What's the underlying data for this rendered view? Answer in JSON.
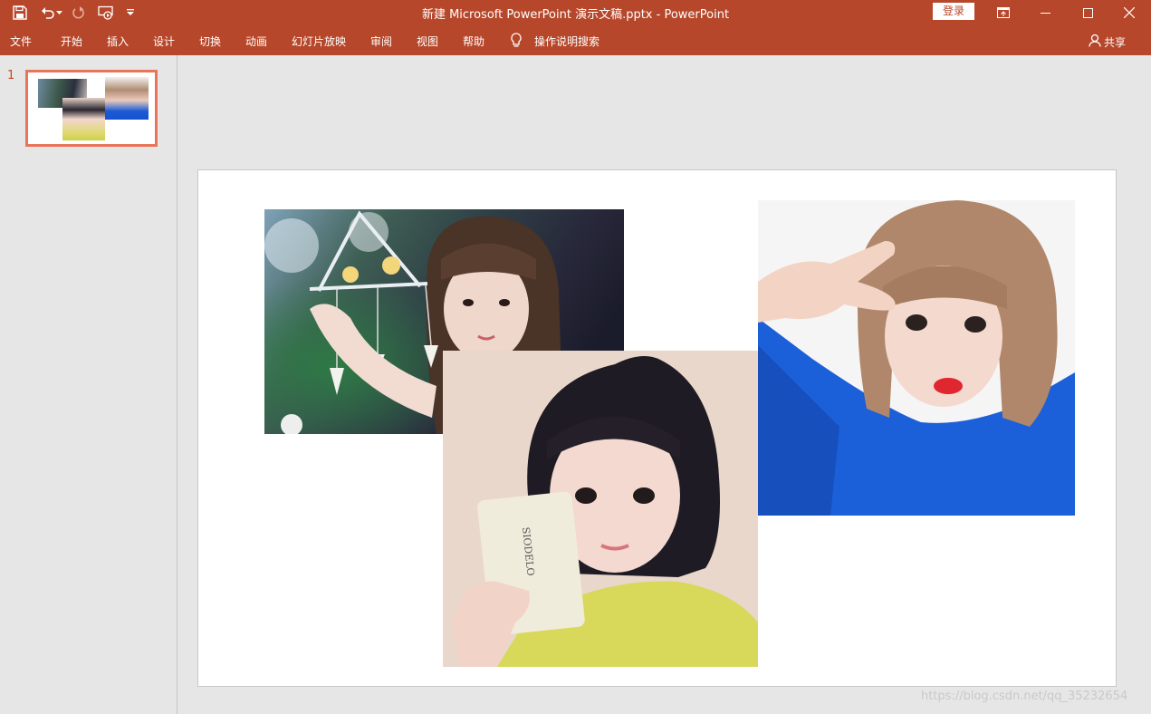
{
  "window": {
    "title": "新建 Microsoft PowerPoint 演示文稿.pptx  -  PowerPoint",
    "signin_label": "登录"
  },
  "quick_access": {
    "icons": [
      "save-icon",
      "undo-icon",
      "dropdown-arrow-icon",
      "redo-icon",
      "present-from-start-icon",
      "customize-toolbar-icon"
    ]
  },
  "ribbon": {
    "tabs": [
      "文件",
      "开始",
      "插入",
      "设计",
      "切换",
      "动画",
      "幻灯片放映",
      "审阅",
      "视图",
      "帮助"
    ],
    "tell_me": "操作说明搜索",
    "share": "共享"
  },
  "slides_pane": {
    "slides": [
      {
        "number": "1",
        "selected": true
      }
    ]
  },
  "slide": {
    "pictures": [
      {
        "name": "photo-girl-wind-chime",
        "description_icon": "image-icon"
      },
      {
        "name": "photo-girl-face-mask",
        "description_icon": "image-icon"
      },
      {
        "name": "photo-girl-blue-sweater",
        "description_icon": "image-icon"
      }
    ]
  },
  "watermark": "https://blog.csdn.net/qq_35232654",
  "colors": {
    "accent": "#b7472a",
    "thumbnail_selection": "#e8755a",
    "workspace": "#e6e6e6"
  }
}
